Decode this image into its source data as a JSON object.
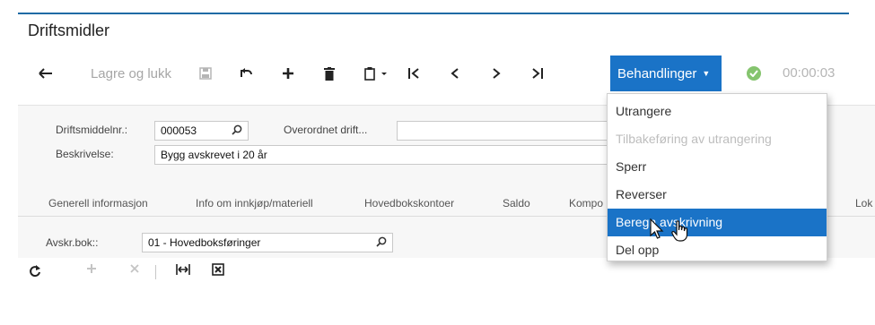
{
  "title": "Driftsmidler",
  "toolbar": {
    "save_close_label": "Lagre og lukk",
    "actions_label": "Behandlinger",
    "timer": "00:00:03",
    "icons": [
      "back-arrow-icon",
      "floppy-save-icon",
      "undo-icon",
      "plus-icon",
      "trash-icon",
      "clipboard-icon",
      "first-record-icon",
      "previous-icon",
      "next-icon",
      "last-record-icon",
      "check-circle-icon"
    ]
  },
  "form": {
    "asset_no_label": "Driftsmiddelnr.:",
    "asset_no_value": "000053",
    "parent_label": "Overordnet drift...",
    "description_label": "Beskrivelse:",
    "description_value": "Bygg avskrevet i 20 år"
  },
  "tabs": [
    "Generell informasjon",
    "Info om innkjøp/materiell",
    "Hovedbokskontoer",
    "Saldo",
    "Kompo",
    "Lok"
  ],
  "book": {
    "label": "Avskr.bok::",
    "value": "01 - Hovedboksføringer"
  },
  "menu": {
    "items": [
      {
        "label": "Utrangere",
        "state": "enabled"
      },
      {
        "label": "Tilbakeføring av utrangering",
        "state": "disabled"
      },
      {
        "label": "Sperr",
        "state": "enabled"
      },
      {
        "label": "Reverser",
        "state": "enabled"
      },
      {
        "label": "Beregn avskrivning",
        "state": "highlighted"
      },
      {
        "label": "Del opp",
        "state": "enabled"
      }
    ]
  },
  "colors": {
    "accent": "#1a73c7",
    "ok": "#85c46e",
    "rule": "#1f6aa5"
  }
}
